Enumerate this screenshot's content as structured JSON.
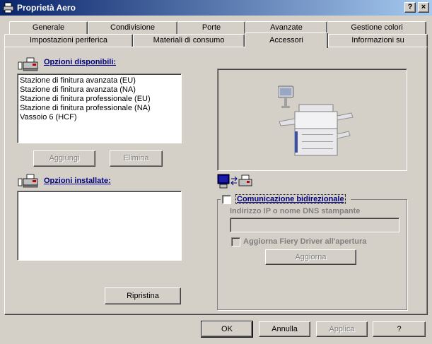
{
  "window": {
    "title": "Proprietà Aero",
    "help_button": "?",
    "close_button": "×"
  },
  "tabs_row1": [
    "Generale",
    "Condivisione",
    "Porte",
    "Avanzate",
    "Gestione colori"
  ],
  "tabs_row2": [
    "Impostazioni periferica",
    "Materiali di consumo",
    "Accessori",
    "Informazioni su"
  ],
  "active_tab": "Accessori",
  "available": {
    "label": "Opzioni disponibili:",
    "items": [
      "Stazione di finitura avanzata (EU)",
      "Stazione di finitura avanzata (NA)",
      "Stazione di finitura professionale (EU)",
      "Stazione di finitura professionale (NA)",
      "Vassoio 6 (HCF)"
    ],
    "add_button": "Aggiungi",
    "remove_button": "Elimina"
  },
  "installed": {
    "label": "Opzioni installate:",
    "items": [],
    "restore_button": "Ripristina"
  },
  "bidirectional": {
    "checkbox_label": "Comunicazione bidirezionale",
    "checked": false,
    "ip_label": "Indirizzo IP o nome DNS stampante",
    "ip_value": "",
    "update_on_open_label": "Aggiorna Fiery Driver all'apertura",
    "update_button": "Aggiorna"
  },
  "footer": {
    "ok": "OK",
    "cancel": "Annulla",
    "apply": "Applica",
    "help": "?"
  },
  "colors": {
    "titlebar_start": "#0a246a",
    "titlebar_end": "#a6caf0",
    "face": "#d4d0c8",
    "link_blue": "#000080"
  }
}
